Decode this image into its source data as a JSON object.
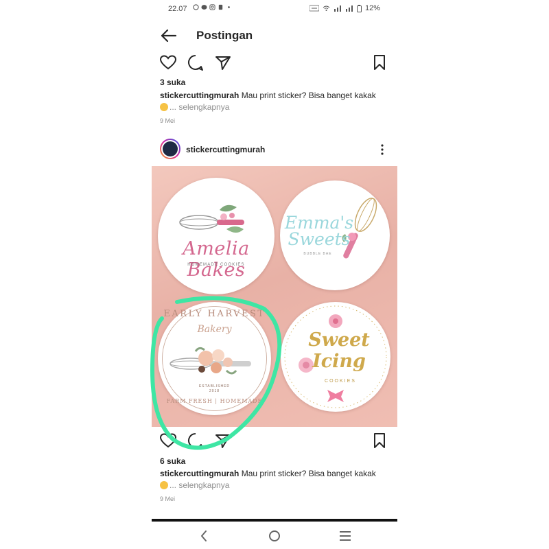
{
  "status_bar": {
    "time": "22.07",
    "battery": "12%"
  },
  "header": {
    "title": "Postingan"
  },
  "posts": [
    {
      "likes": "3 suka",
      "username": "stickercuttingmurah",
      "caption": "Mau print sticker? Bisa banget kakak",
      "more": "... selengkapnya",
      "date": "9 Mei"
    },
    {
      "username": "stickercuttingmurah",
      "likes": "6 suka",
      "caption": "Mau print sticker? Bisa banget kakak",
      "more": "... selengkapnya",
      "date": "9 Mei",
      "stickers": [
        {
          "title": "Amelia Bakes",
          "subtitle": "HOMEMADE COOKIES"
        },
        {
          "title": "Emma's Sweets",
          "subtitle": "BUBBLE BAE"
        },
        {
          "title": "EARLY HARVEST",
          "script": "Bakery",
          "line1": "ESTABLISHED",
          "line2": "2018",
          "bottom": "FARM FRESH | HOMEMADE"
        },
        {
          "title": "Sweet Icing",
          "subtitle": "COOKIES"
        }
      ]
    }
  ],
  "icons": {
    "back": "arrow-left-icon",
    "like": "heart-icon",
    "comment": "comment-icon",
    "share": "send-icon",
    "save": "bookmark-icon",
    "more": "more-vertical-icon",
    "nav_back": "chevron-left-icon",
    "nav_home": "circle-home-icon",
    "nav_recent": "menu-lines-icon"
  },
  "colors": {
    "annotation_stroke": "#3ee6a4",
    "post_background": "#f0bfb4"
  }
}
